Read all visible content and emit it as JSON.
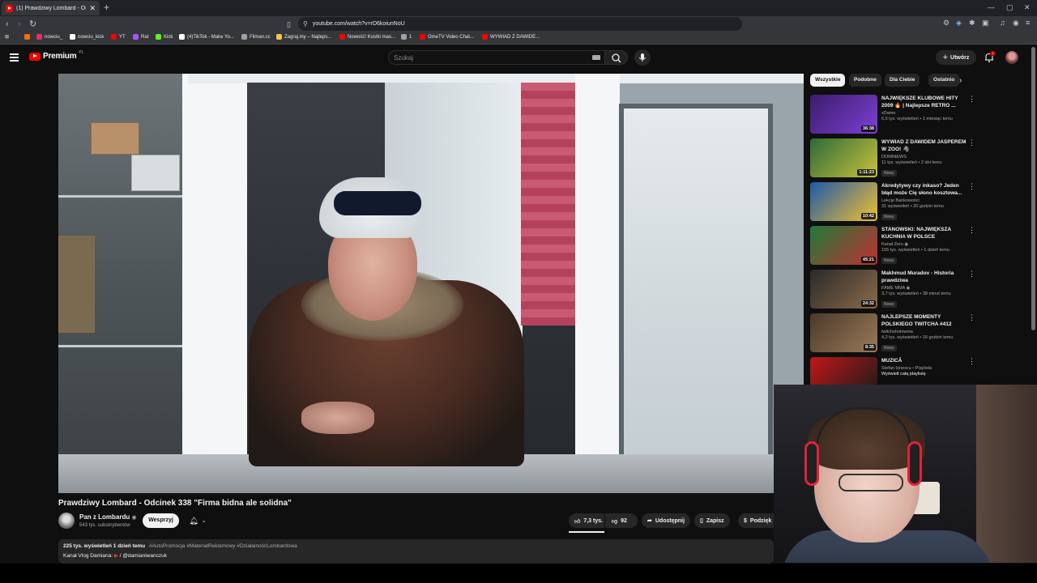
{
  "browser": {
    "tab_title": "(1) Prawdziwy Lombard - Od",
    "url": "youtube.com/watch?v=rD6koiunNoU",
    "bookmarks": [
      {
        "label": "nowciu_",
        "color": "#e1306c"
      },
      {
        "label": "nowciu_kick",
        "color": "#ffffff"
      },
      {
        "label": "YT",
        "color": "#ff0000"
      },
      {
        "label": "Rat",
        "color": "#a855f7"
      },
      {
        "label": "Kick",
        "color": "#53fc18"
      },
      {
        "label": "(4)TikTok - Make Yo...",
        "color": "#ffffff"
      },
      {
        "label": "Filman.cc",
        "color": "#9aa0a6"
      },
      {
        "label": "Zagraj.my – Najleps...",
        "color": "#f5c542"
      },
      {
        "label": "Nowość! Kostki mas...",
        "color": "#ff0000"
      },
      {
        "label": "1",
        "color": "#9aa0a6"
      },
      {
        "label": "OmeTV Video Chat...",
        "color": "#ff0000"
      },
      {
        "label": "WYWIAD Z DAWIDE...",
        "color": "#ff0000"
      }
    ]
  },
  "youtube": {
    "logo_text": "Premium",
    "logo_region": "PL",
    "search_placeholder": "Szukaj",
    "create_label": "Utwórz",
    "notification_count": "1"
  },
  "video": {
    "title": "Prawdziwy Lombard - Odcinek 338 \"Firma bidna ale solidna\"",
    "channel": "Pan z Lombardu",
    "verified": "◉",
    "subscribers": "543 tys. subskrybentów",
    "support_label": "Wesprzyj",
    "likes": "7,3 tys.",
    "dislikes": "92",
    "share_label": "Udostępnij",
    "save_label": "Zapisz",
    "thanks_label": "Podzięk",
    "views_line": "225 tys. wyświetleń  1 dzień temu",
    "hashtags": "#AutoPromocja #MateriałReklamowy #DziałalnośćLombardowa",
    "desc_line2_prefix": "Kanał Vlog Damiana:",
    "desc_line2_handle": "/ @damianiwanczuk"
  },
  "chips": [
    "Wszystkie",
    "Podobne",
    "Dla Ciebie",
    "Ostatnio"
  ],
  "recommendations": [
    {
      "title": "NAJWIĘKSZE KLUBOWE HITY 2009 🔥 | Najlepsze RETRO ...",
      "channel": "xDame",
      "meta": "6,5 tys. wyświetleń • 1 miesiąc temu",
      "duration": "36:38",
      "badge": "",
      "colors": [
        "#3b1d6b",
        "#7e3fd6"
      ]
    },
    {
      "title": "WYWIAD Z DAWIDEM JASPEREM W ZOO! 🦓",
      "channel": "DOMINEWS",
      "meta": "11 tys. wyświetleń • 2 dni temu",
      "duration": "1:11:23",
      "badge": "Nowy",
      "colors": [
        "#2d6a3a",
        "#c9c23a"
      ]
    },
    {
      "title": "Akredytywy czy inkaso? Jeden błąd może Cię słono kosztowa...",
      "channel": "Lekcje Bankowości",
      "meta": "31 wyświetleń • 20 godzin temu",
      "duration": "10:42",
      "badge": "Nowy",
      "colors": [
        "#1e5aa8",
        "#f0c030"
      ]
    },
    {
      "title": "STANOWSKI: NAJWIĘKSZA KUCHNIA W POLSCE",
      "channel": "Kanał Zero ◉",
      "meta": "155 tys. wyświetleń • 1 dzień temu",
      "duration": "45:21",
      "badge": "Nowy",
      "colors": [
        "#1f7a3a",
        "#c03030"
      ]
    },
    {
      "title": "Makhmud Muradov - Historia prawdziwa",
      "channel": "FAME MMA ◉",
      "meta": "3,7 tys. wyświetleń • 38 minut temu",
      "duration": "24:32",
      "badge": "Nowy",
      "colors": [
        "#2a2a2a",
        "#8a6a4a"
      ]
    },
    {
      "title": "NAJLEPSZE MOMENTY POLSKIEGO TWITCHA #412",
      "channel": "twitchshotownia",
      "meta": "4,2 tys. wyświetleń • 16 godzin temu",
      "duration": "8:35",
      "badge": "Nowy",
      "colors": [
        "#4a3a2a",
        "#9a7a5a"
      ]
    },
    {
      "title": "MUZICĂ",
      "channel": "Stefan Ionescu • Playlista",
      "meta": "",
      "duration": "",
      "badge": "",
      "playlist_link": "Wyświetl całą playlistę",
      "colors": [
        "#c01818",
        "#1a1a1a"
      ]
    }
  ]
}
